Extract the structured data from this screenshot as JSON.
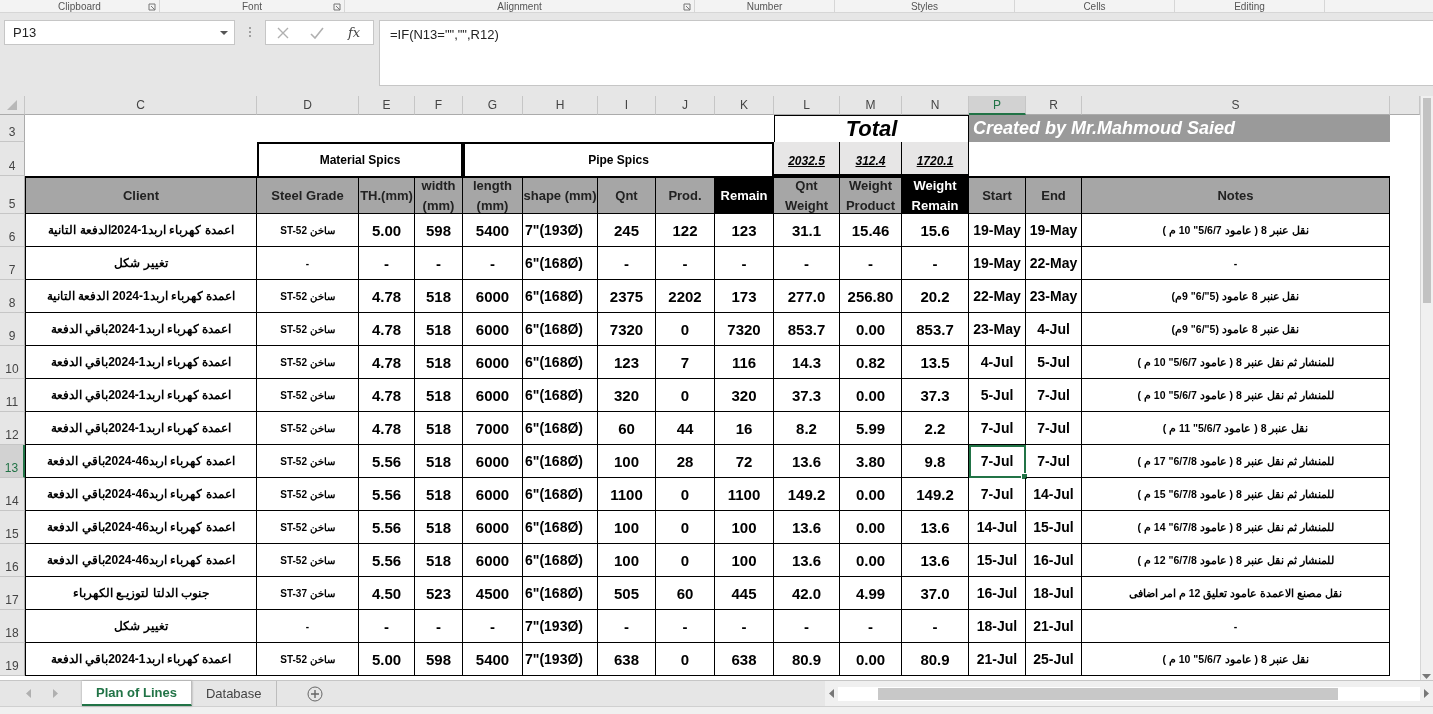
{
  "ribbon_groups": [
    {
      "label": "Clipboard",
      "launcher": true
    },
    {
      "label": "Font",
      "launcher": true
    },
    {
      "label": "Alignment",
      "launcher": true
    },
    {
      "label": "Number",
      "launcher": false
    },
    {
      "label": "Styles",
      "launcher": false
    },
    {
      "label": "Cells",
      "launcher": false
    },
    {
      "label": "Editing",
      "launcher": false
    }
  ],
  "name_box": "P13",
  "function_button": "fx",
  "formula": "=IF(N13=\"\",\"\",R12)",
  "column_headers": [
    {
      "label": "C",
      "selected": false
    },
    {
      "label": "D",
      "selected": false
    },
    {
      "label": "E",
      "selected": false
    },
    {
      "label": "F",
      "selected": false
    },
    {
      "label": "G",
      "selected": false
    },
    {
      "label": "H",
      "selected": false
    },
    {
      "label": "I",
      "selected": false
    },
    {
      "label": "J",
      "selected": false
    },
    {
      "label": "K",
      "selected": false
    },
    {
      "label": "L",
      "selected": false
    },
    {
      "label": "M",
      "selected": false
    },
    {
      "label": "N",
      "selected": false
    },
    {
      "label": "P",
      "selected": true
    },
    {
      "label": "R",
      "selected": false
    },
    {
      "label": "S",
      "selected": false
    }
  ],
  "row_headers": [
    {
      "label": "3",
      "selected": false
    },
    {
      "label": "4",
      "selected": false
    },
    {
      "label": "5",
      "selected": false
    }
  ],
  "total": {
    "label": "Total",
    "values": [
      "2032.5",
      "312.4",
      "1720.1"
    ]
  },
  "credit": "Created by Mr.Mahmoud Saied",
  "groups": [
    "Material Spics",
    "Pipe Spics"
  ],
  "table": {
    "columns": [
      {
        "label": "Client",
        "kind": "light"
      },
      {
        "label": "Steel Grade",
        "kind": "light"
      },
      {
        "label": "TH.(mm)",
        "kind": "light"
      },
      {
        "label": "width (mm)",
        "kind": "light"
      },
      {
        "label": "length (mm)",
        "kind": "light"
      },
      {
        "label": "shape (mm)",
        "kind": "light"
      },
      {
        "label": "Qnt",
        "kind": "light"
      },
      {
        "label": "Prod.",
        "kind": "light"
      },
      {
        "label": "Remain",
        "kind": "dark"
      },
      {
        "label": "Qnt Weight",
        "kind": "light"
      },
      {
        "label": "Weight Product",
        "kind": "light"
      },
      {
        "label": "Weight Remain",
        "kind": "dark"
      },
      {
        "label": "Start",
        "kind": "light"
      },
      {
        "label": "End",
        "kind": "light"
      },
      {
        "label": "Notes",
        "kind": "light"
      }
    ],
    "rows": [
      {
        "header": "6",
        "selected": false,
        "cells": [
          "اعمدة كهرباء اربد1-2024الدفعة التانية",
          "ساخن ST-52",
          "5.00",
          "598",
          "5400",
          "7\"(193Ø)",
          "245",
          "122",
          "123",
          "31.1",
          "15.46",
          "15.6",
          "19-May",
          "19-May",
          "نقل عنبر 8 ( عامود 5/6/7\" 10 م )"
        ]
      },
      {
        "header": "7",
        "selected": false,
        "cells": [
          "تغيير شكل",
          "-",
          "-",
          "-",
          "-",
          "6\"(168Ø)",
          "-",
          "-",
          "-",
          "-",
          "-",
          "-",
          "19-May",
          "22-May",
          "-"
        ]
      },
      {
        "header": "8",
        "selected": false,
        "cells": [
          "اعمدة كهرباء اربد1-2024 الدفعة التانية",
          "ساخن ST-52",
          "4.78",
          "518",
          "6000",
          "6\"(168Ø)",
          "2375",
          "2202",
          "173",
          "277.0",
          "256.80",
          "20.2",
          "22-May",
          "23-May",
          "نقل عنبر 8 عامود (5\"/6\" 9م)"
        ]
      },
      {
        "header": "9",
        "selected": false,
        "cells": [
          "اعمدة كهرباء اربد1-2024باقي الدفعة",
          "ساخن ST-52",
          "4.78",
          "518",
          "6000",
          "6\"(168Ø)",
          "7320",
          "0",
          "7320",
          "853.7",
          "0.00",
          "853.7",
          "23-May",
          "4-Jul",
          "نقل عنبر 8 عامود (5\"/6\" 9م)"
        ]
      },
      {
        "header": "10",
        "selected": false,
        "cells": [
          "اعمدة كهرباء اربد1-2024باقي الدفعة",
          "ساخن ST-52",
          "4.78",
          "518",
          "6000",
          "6\"(168Ø)",
          "123",
          "7",
          "116",
          "14.3",
          "0.82",
          "13.5",
          "4-Jul",
          "5-Jul",
          "للمنشار ثم نقل عنبر 8 ( عامود 5/6/7\" 10 م )"
        ]
      },
      {
        "header": "11",
        "selected": false,
        "cells": [
          "اعمدة كهرباء اربد1-2024باقي الدفعة",
          "ساخن ST-52",
          "4.78",
          "518",
          "6000",
          "6\"(168Ø)",
          "320",
          "0",
          "320",
          "37.3",
          "0.00",
          "37.3",
          "5-Jul",
          "7-Jul",
          "للمنشار ثم نقل عنبر 8 ( عامود 5/6/7\" 10 م )"
        ]
      },
      {
        "header": "12",
        "selected": false,
        "cells": [
          "اعمدة كهرباء اربد1-2024باقي الدفعة",
          "ساخن ST-52",
          "4.78",
          "518",
          "7000",
          "6\"(168Ø)",
          "60",
          "44",
          "16",
          "8.2",
          "5.99",
          "2.2",
          "7-Jul",
          "7-Jul",
          "نقل عنبر 8 ( عامود 5/6/7\" 11 م )"
        ]
      },
      {
        "header": "13",
        "selected": true,
        "active": [
          false,
          false,
          false,
          false,
          false,
          false,
          false,
          false,
          false,
          false,
          false,
          false,
          true,
          false,
          false
        ],
        "cells": [
          "اعمدة كهرباء اربد46-2024باقي الدفعة",
          "ساخن ST-52",
          "5.56",
          "518",
          "6000",
          "6\"(168Ø)",
          "100",
          "28",
          "72",
          "13.6",
          "3.80",
          "9.8",
          "7-Jul",
          "7-Jul",
          "للمنشار ثم نقل عنبر 8 ( عامود 6/7/8\" 17 م )"
        ]
      },
      {
        "header": "14",
        "selected": false,
        "cells": [
          "اعمدة كهرباء اربد46-2024باقي الدفعة",
          "ساخن ST-52",
          "5.56",
          "518",
          "6000",
          "6\"(168Ø)",
          "1100",
          "0",
          "1100",
          "149.2",
          "0.00",
          "149.2",
          "7-Jul",
          "14-Jul",
          "للمنشار ثم نقل عنبر 8 ( عامود 6/7/8\" 15 م )"
        ]
      },
      {
        "header": "15",
        "selected": false,
        "cells": [
          "اعمدة كهرباء اربد46-2024باقي الدفعة",
          "ساخن ST-52",
          "5.56",
          "518",
          "6000",
          "6\"(168Ø)",
          "100",
          "0",
          "100",
          "13.6",
          "0.00",
          "13.6",
          "14-Jul",
          "15-Jul",
          "للمنشار ثم نقل عنبر 8 ( عامود 6/7/8\" 14 م )"
        ]
      },
      {
        "header": "16",
        "selected": false,
        "cells": [
          "اعمدة كهرباء اربد46-2024باقي الدفعة",
          "ساخن ST-52",
          "5.56",
          "518",
          "6000",
          "6\"(168Ø)",
          "100",
          "0",
          "100",
          "13.6",
          "0.00",
          "13.6",
          "15-Jul",
          "16-Jul",
          "للمنشار ثم نقل عنبر 8 ( عامود 6/7/8\" 12 م )"
        ]
      },
      {
        "header": "17",
        "selected": false,
        "cells": [
          "جنوب الدلتا لتوزيـع الكهرباء",
          "ساخن ST-37",
          "4.50",
          "523",
          "4500",
          "6\"(168Ø)",
          "505",
          "60",
          "445",
          "42.0",
          "4.99",
          "37.0",
          "16-Jul",
          "18-Jul",
          "نقل مصنع الاعمدة عامود تعليق 12 م امر اضافى"
        ]
      },
      {
        "header": "18",
        "selected": false,
        "cells": [
          "تغيير شكل",
          "-",
          "-",
          "-",
          "-",
          "7\"(193Ø)",
          "-",
          "-",
          "-",
          "-",
          "-",
          "-",
          "18-Jul",
          "21-Jul",
          "-"
        ]
      },
      {
        "header": "19",
        "selected": false,
        "cells": [
          "اعمدة كهرباء اربد1-2024باقي الدفعة",
          "ساخن ST-52",
          "5.00",
          "598",
          "5400",
          "7\"(193Ø)",
          "638",
          "0",
          "638",
          "80.9",
          "0.00",
          "80.9",
          "21-Jul",
          "25-Jul",
          "نقل عنبر 8 ( عامود 5/6/7\" 10 م )"
        ]
      }
    ]
  },
  "sheet_tabs": [
    {
      "label": "Plan of Lines",
      "selected": true
    },
    {
      "label": "Database",
      "selected": false
    }
  ]
}
